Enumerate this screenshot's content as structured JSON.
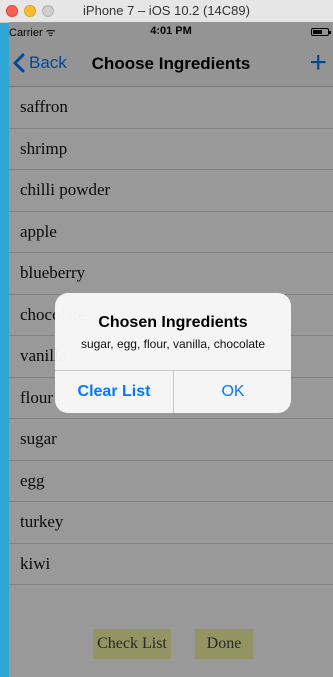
{
  "simulator": {
    "title": "iPhone 7 – iOS 10.2 (14C89)"
  },
  "statusbar": {
    "carrier": "Carrier ᯤ",
    "time": "4:01 PM"
  },
  "navbar": {
    "back_label": "Back",
    "title": "Choose Ingredients",
    "add_label": "+"
  },
  "ingredients": [
    "saffron",
    "shrimp",
    "chilli powder",
    "apple",
    "blueberry",
    "chocolate",
    "vanilla",
    "flour",
    "sugar",
    "egg",
    "turkey",
    "kiwi"
  ],
  "toolbar": {
    "check_list_label": "Check List",
    "done_label": "Done"
  },
  "alert": {
    "title": "Chosen Ingredients",
    "message": "sugar, egg, flour, vanilla, chocolate",
    "clear_label": "Clear List",
    "ok_label": "OK"
  },
  "colors": {
    "accent": "#007aff",
    "button_yellow": "#f5f5a6",
    "window_blue": "#2ea6d6"
  }
}
